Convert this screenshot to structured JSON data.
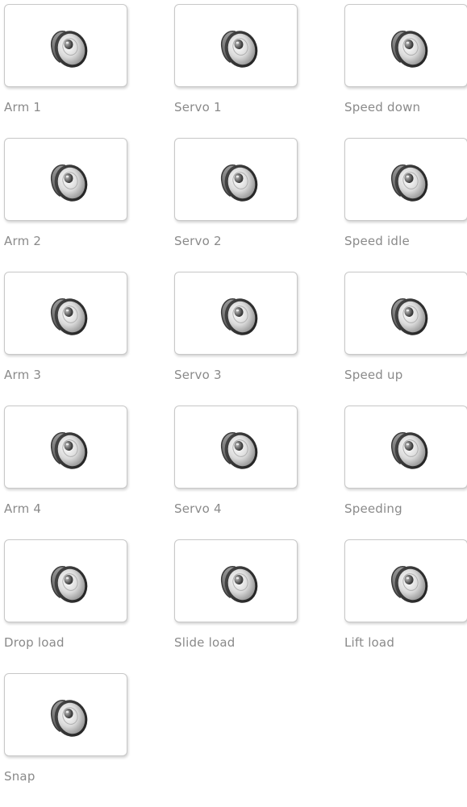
{
  "sounds": [
    {
      "label": "Arm 1",
      "icon": "speaker-icon"
    },
    {
      "label": "Servo 1",
      "icon": "speaker-icon"
    },
    {
      "label": "Speed down",
      "icon": "speaker-icon"
    },
    {
      "label": "Arm 2",
      "icon": "speaker-icon"
    },
    {
      "label": "Servo 2",
      "icon": "speaker-icon"
    },
    {
      "label": "Speed idle",
      "icon": "speaker-icon"
    },
    {
      "label": "Arm 3",
      "icon": "speaker-icon"
    },
    {
      "label": "Servo 3",
      "icon": "speaker-icon"
    },
    {
      "label": "Speed up",
      "icon": "speaker-icon"
    },
    {
      "label": "Arm 4",
      "icon": "speaker-icon"
    },
    {
      "label": "Servo 4",
      "icon": "speaker-icon"
    },
    {
      "label": "Speeding",
      "icon": "speaker-icon"
    },
    {
      "label": "Drop load",
      "icon": "speaker-icon"
    },
    {
      "label": "Slide load",
      "icon": "speaker-icon"
    },
    {
      "label": "Lift load",
      "icon": "speaker-icon"
    },
    {
      "label": "Snap",
      "icon": "speaker-icon"
    }
  ]
}
